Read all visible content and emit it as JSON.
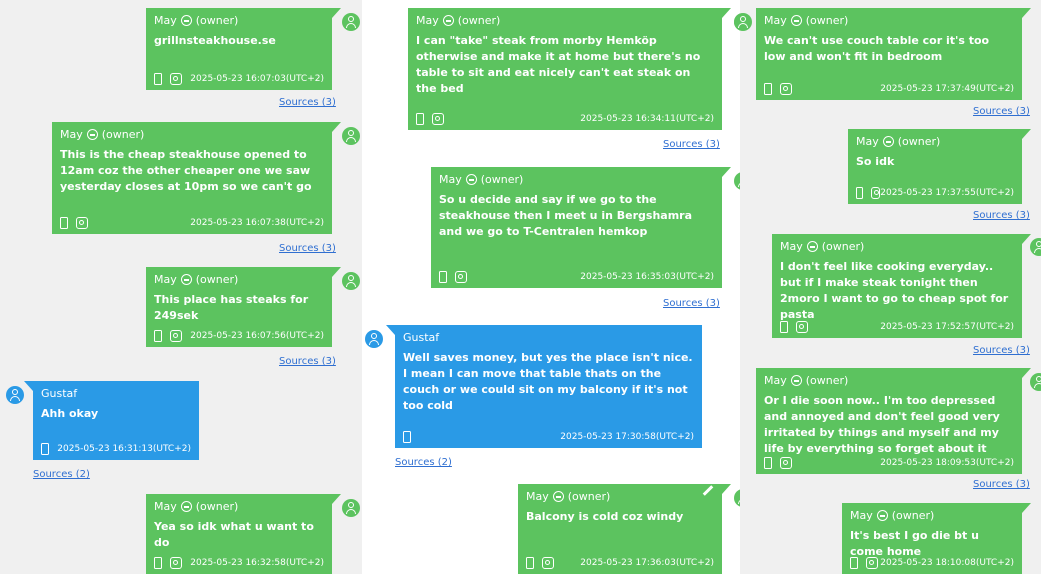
{
  "owner_label": "(owner)",
  "sources_label": {
    "three": "Sources (3)",
    "two": "Sources (2)"
  },
  "colors": {
    "owner_bubble": "#5cc35f",
    "other_bubble": "#2a9ae6",
    "link": "#2f6fd1"
  },
  "messages": [
    {
      "author": "May",
      "text": "grillnsteakhouse.se",
      "time": "2025-05-23 16:07:03(UTC+2)"
    },
    {
      "author": "May",
      "text": "This is the cheap steakhouse opened to 12am coz the other cheaper one we saw yesterday closes at 10pm so we can't go",
      "time": "2025-05-23 16:07:38(UTC+2)"
    },
    {
      "author": "May",
      "text": "This place has steaks for 249sek",
      "time": "2025-05-23 16:07:56(UTC+2)"
    },
    {
      "author": "Gustaf",
      "text": "Ahh okay",
      "time": "2025-05-23 16:31:13(UTC+2)"
    },
    {
      "author": "May",
      "text": "Yea so idk what u want to do",
      "time": "2025-05-23 16:32:58(UTC+2)"
    },
    {
      "author": "May",
      "text": "I can \"take\" steak from morby Hemköp otherwise and make it at home but there's no table to sit and eat nicely can't eat steak on the bed",
      "time": "2025-05-23 16:34:11(UTC+2)"
    },
    {
      "author": "May",
      "text": "So u decide and say if we go to the steakhouse then I meet u in Bergshamra and we go to T-Centralen hemkop",
      "time": "2025-05-23 16:35:03(UTC+2)"
    },
    {
      "author": "Gustaf",
      "text": "Well saves money, but yes the place isn't nice. I mean I can move that table thats on the couch or we could sit on my balcony if it's not too cold",
      "time": "2025-05-23 17:30:58(UTC+2)"
    },
    {
      "author": "May",
      "text": "Balcony is cold coz windy",
      "time": "2025-05-23 17:36:03(UTC+2)"
    },
    {
      "author": "May",
      "text": "We can't use couch table cor it's too low and won't fit in bedroom",
      "time": "2025-05-23 17:37:49(UTC+2)"
    },
    {
      "author": "May",
      "text": "So idk",
      "time": "2025-05-23 17:37:55(UTC+2)"
    },
    {
      "author": "May",
      "text": "I don't feel like cooking everyday.. but if I make steak tonight then 2moro I want to go to cheap spot for pasta",
      "time": "2025-05-23 17:52:57(UTC+2)"
    },
    {
      "author": "May",
      "text": "Or I die soon now.. I'm too depressed and annoyed and don't feel good very irritated by things and myself and my life by everything so forget about it",
      "time": "2025-05-23 18:09:53(UTC+2)"
    },
    {
      "author": "May",
      "text": "It's best I go die bt u come home",
      "time": "2025-05-23 18:10:08(UTC+2)"
    }
  ]
}
